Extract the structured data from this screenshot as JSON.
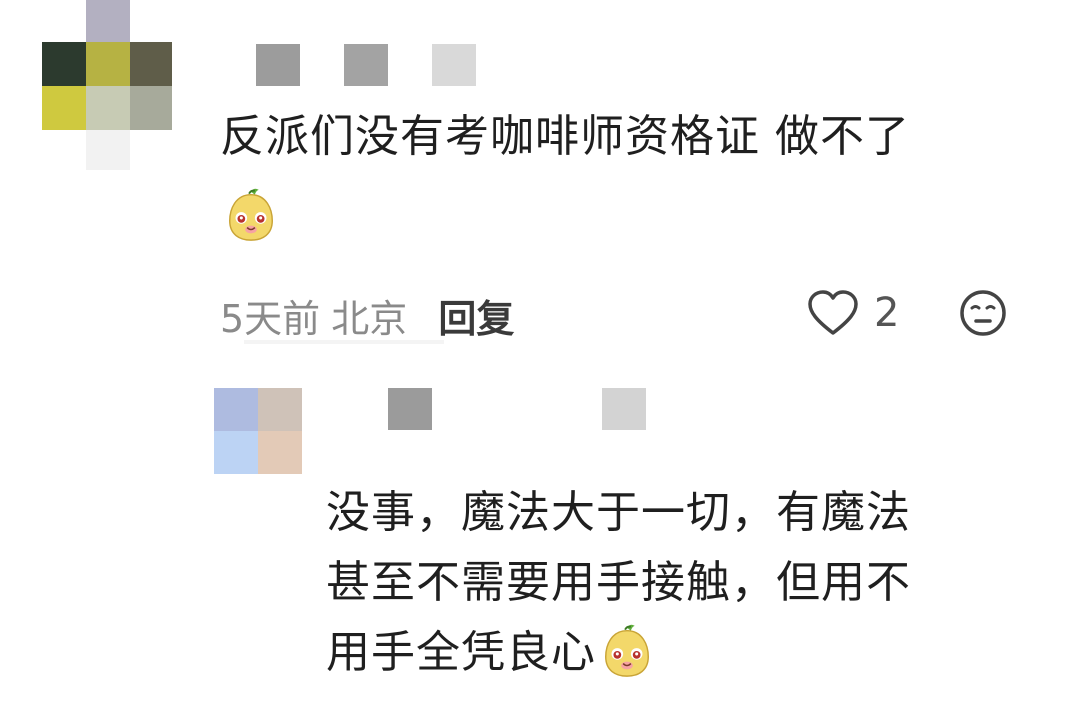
{
  "comment": {
    "text": "反派们没有考咖啡师资格证 做不了",
    "emoji": "pear-face-emoji",
    "time": "5天前",
    "location": "北京",
    "reply_label": "回复",
    "like_count": "2"
  },
  "reply": {
    "line1": "没事，魔法大于一切，有魔法",
    "line2": "甚至不需要用手接触，但用不",
    "line3": "用手全凭良心",
    "emoji": "pear-face-emoji"
  },
  "colors": {
    "text": "#1f1f1f",
    "meta": "#8a8a8a",
    "icon": "#444444"
  }
}
